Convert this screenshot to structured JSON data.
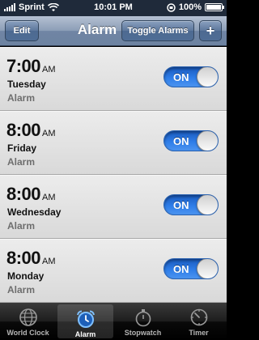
{
  "status_bar": {
    "carrier": "Sprint",
    "time": "10:01 PM",
    "battery": "100%"
  },
  "navbar": {
    "edit_label": "Edit",
    "title": "Alarm",
    "toggle_label": "Toggle Alarms",
    "add_label": "+"
  },
  "alarms": [
    {
      "time": "7:00",
      "ampm": "AM",
      "day": "Tuesday",
      "label": "Alarm",
      "switch": "ON"
    },
    {
      "time": "8:00",
      "ampm": "AM",
      "day": "Friday",
      "label": "Alarm",
      "switch": "ON"
    },
    {
      "time": "8:00",
      "ampm": "AM",
      "day": "Wednesday",
      "label": "Alarm",
      "switch": "ON"
    },
    {
      "time": "8:00",
      "ampm": "AM",
      "day": "Monday",
      "label": "Alarm",
      "switch": "ON"
    }
  ],
  "tabs": [
    {
      "label": "World Clock",
      "icon": "globe-icon"
    },
    {
      "label": "Alarm",
      "icon": "alarm-clock-icon",
      "active": true
    },
    {
      "label": "Stopwatch",
      "icon": "stopwatch-icon"
    },
    {
      "label": "Timer",
      "icon": "timer-icon"
    }
  ],
  "colors": {
    "switch_on": "#2e7de8",
    "navbar": "#7085a4",
    "tab_active_icon": "#5aa9ff"
  }
}
